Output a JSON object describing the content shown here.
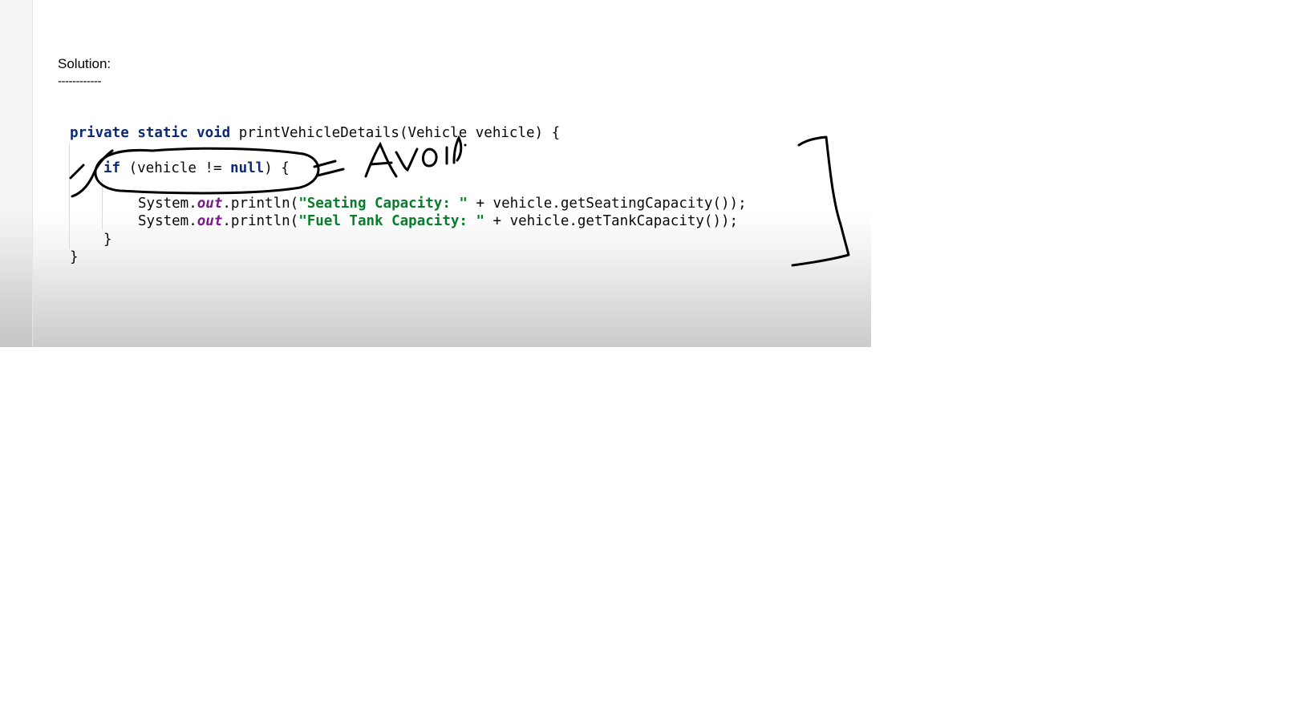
{
  "slide": {
    "heading": "Solution:",
    "heading_rule": "------------"
  },
  "code": {
    "line1": {
      "kw1": "private",
      "kw2": "static",
      "kw3": "void",
      "rest": " printVehicleDetails(Vehicle vehicle) {"
    },
    "line2": {
      "kw": "if",
      "mid": " (vehicle != ",
      "kw_null": "null",
      "rest": ") {"
    },
    "line3": {
      "pre": "System.",
      "field": "out",
      "mid": ".println(",
      "str": "\"Seating Capacity: \"",
      "rest": " + vehicle.getSeatingCapacity());"
    },
    "line4": {
      "pre": "System.",
      "field": "out",
      "mid": ".println(",
      "str": "\"Fuel Tank Capacity: \"",
      "rest": " + vehicle.getTankCapacity());"
    },
    "line5": "}",
    "line6": "}"
  },
  "annotation": {
    "handwritten_text": "Avoid"
  },
  "colors": {
    "keyword": "#0c2a7a",
    "string": "#097d2b",
    "field": "#7a1a8a",
    "ink": "#000000"
  }
}
